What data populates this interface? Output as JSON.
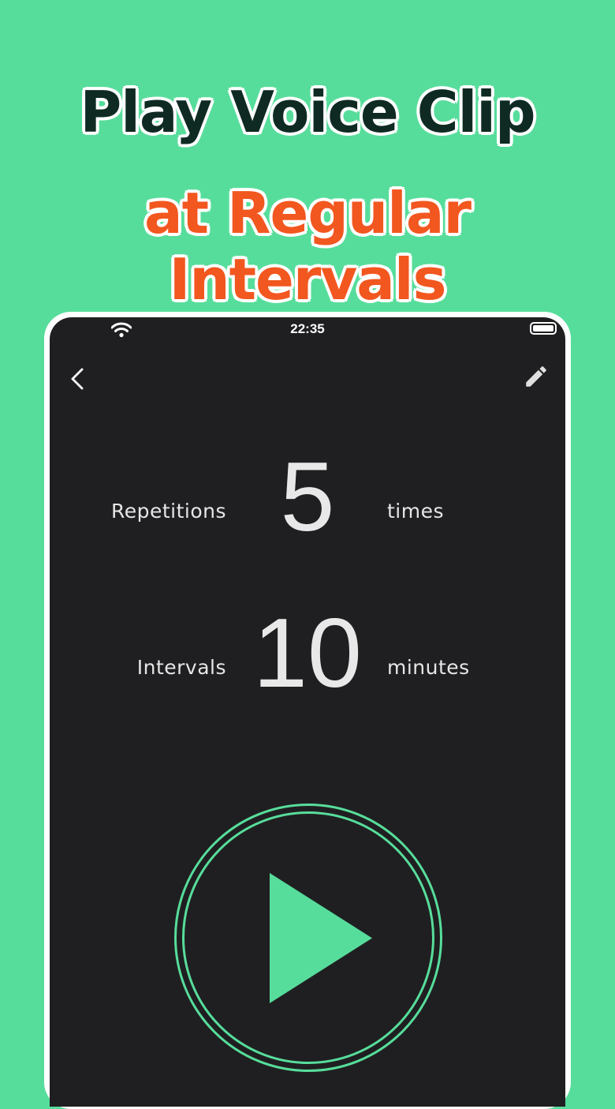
{
  "headline": {
    "line1": "Play Voice Clip",
    "line2": "at Regular Intervals"
  },
  "colors": {
    "background": "#57dd9b",
    "accent": "#57dd9b",
    "headline_dark": "#0f2a22",
    "headline_orange": "#f2571f",
    "screen": "#1f1f21"
  },
  "status_bar": {
    "time": "22:35",
    "icons": [
      "wifi-icon",
      "battery-icon"
    ]
  },
  "nav": {
    "icons": [
      "back-chevron-icon",
      "edit-pencil-icon"
    ]
  },
  "repetitions": {
    "label": "Repetitions",
    "value": "5",
    "unit": "times"
  },
  "intervals": {
    "label": "Intervals",
    "value": "10",
    "unit": "minutes"
  },
  "play": {
    "icon": "play-icon"
  }
}
